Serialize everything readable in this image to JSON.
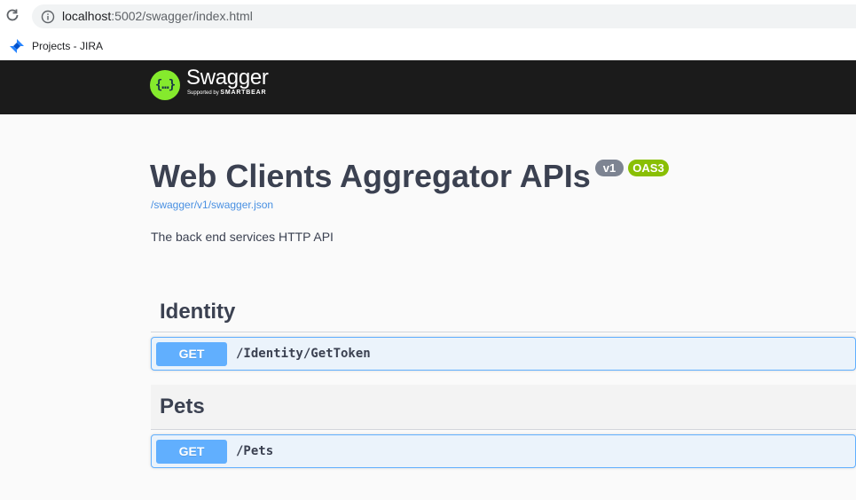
{
  "browser": {
    "url_host": "localhost",
    "url_rest": ":5002/swagger/index.html",
    "bookmark_label": "Projects - JIRA",
    "icons": [
      "reload-icon",
      "info-icon",
      "jira-icon"
    ]
  },
  "topbar": {
    "logo_title": "Swagger",
    "logo_supported": "Supported by",
    "logo_brand": "SMARTBEAR"
  },
  "info": {
    "title": "Web Clients Aggregator APIs",
    "version_badge": "v1",
    "oas_badge": "OAS3",
    "spec_link": "/swagger/v1/swagger.json",
    "description": "The back end services HTTP API"
  },
  "tags": [
    {
      "name": "Identity",
      "operations": [
        {
          "method": "GET",
          "path": "/Identity/GetToken"
        }
      ]
    },
    {
      "name": "Pets",
      "operations": [
        {
          "method": "GET",
          "path": "/Pets"
        }
      ]
    }
  ],
  "colors": {
    "get": "#61affe",
    "topbar": "#1b1b1b",
    "logo": "#85ea2d",
    "oas": "#89bf04",
    "version": "#7d8492"
  }
}
